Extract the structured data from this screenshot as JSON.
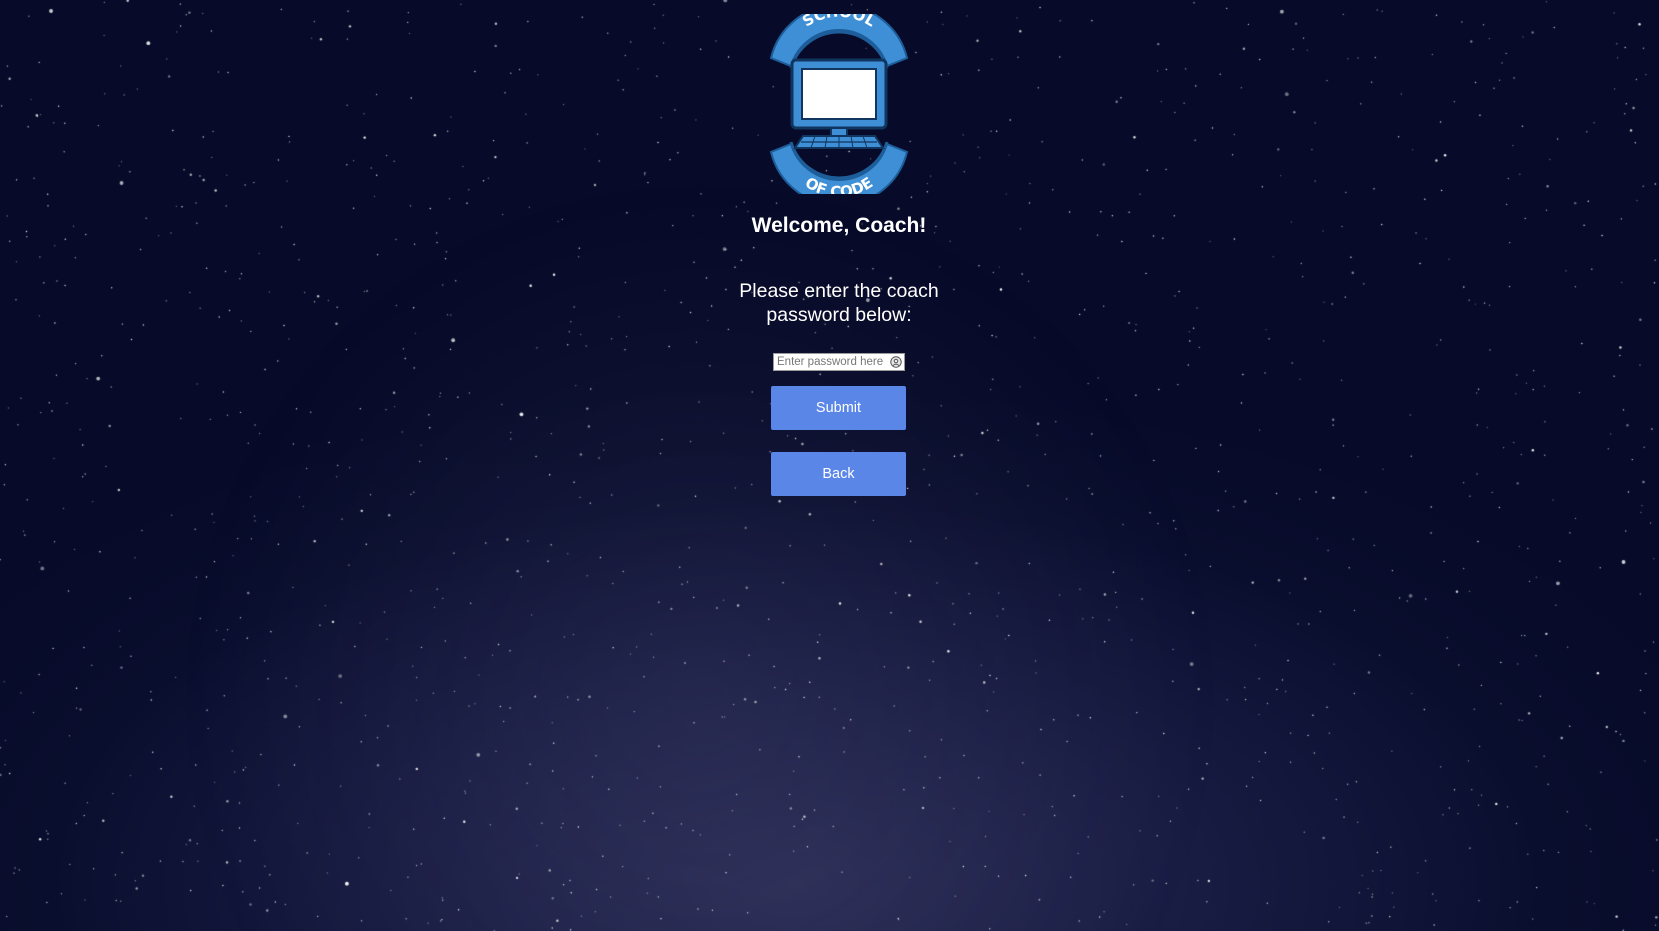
{
  "logo": {
    "top_text": "SCHOOL",
    "bottom_text": "OF CODE",
    "icon": "computer-monitor-icon"
  },
  "page": {
    "title": "Welcome, Coach!",
    "prompt": "Please enter the coach password below:"
  },
  "password": {
    "placeholder": "Enter password here",
    "value": "",
    "icon": "password-manager-key-icon"
  },
  "buttons": {
    "submit_label": "Submit",
    "back_label": "Back"
  },
  "colors": {
    "background": "#0a0e2e",
    "button": "#5a86e8",
    "logo_blue": "#3f8fd6",
    "text": "#ffffff"
  }
}
